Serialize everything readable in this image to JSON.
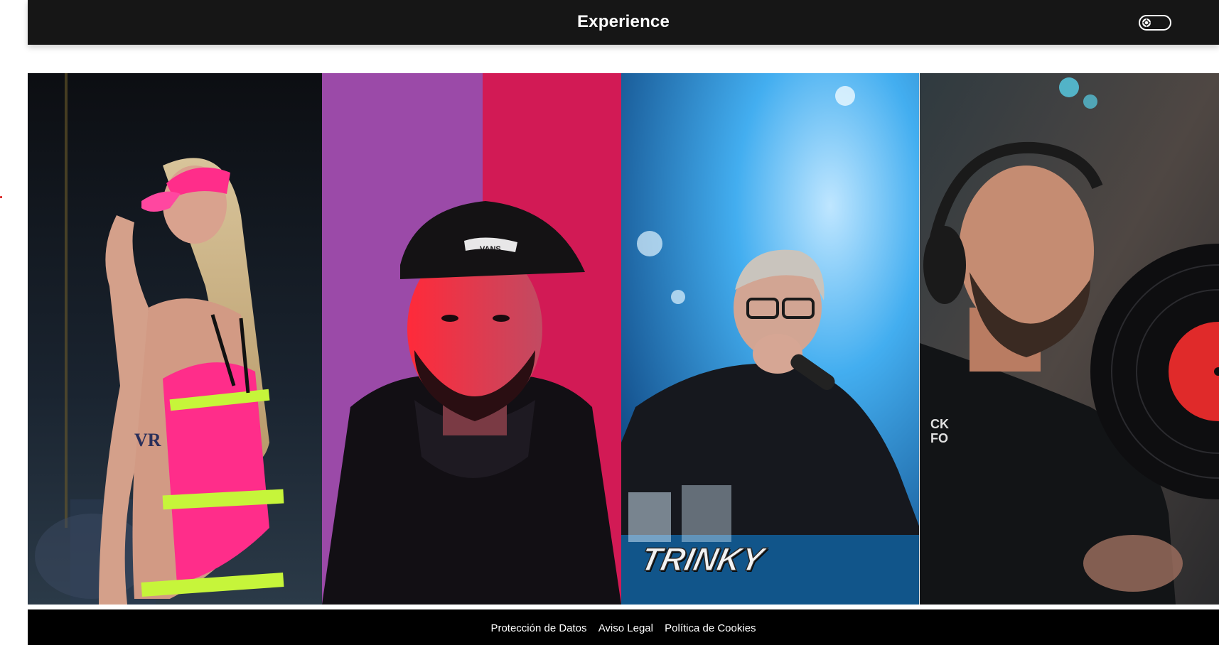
{
  "header": {
    "title": "Experience",
    "toggle_icon": "gear-icon"
  },
  "gallery": {
    "items": [
      {
        "icon": "performer-photo",
        "description_visible": false
      },
      {
        "icon": "artist-portrait-photo",
        "description_visible": false
      },
      {
        "icon": "mc-performer-photo",
        "caption": "TRINKY"
      },
      {
        "icon": "dj-vinyl-photo",
        "description_visible": false
      }
    ]
  },
  "footer": {
    "links": [
      {
        "label": "Protección de Datos"
      },
      {
        "label": "Aviso Legal"
      },
      {
        "label": "Política de Cookies"
      }
    ]
  },
  "colors": {
    "header_bg": "#161616",
    "footer_bg": "#000000",
    "accent_pink": "#ff2d8a",
    "accent_blue": "#2a9ee8",
    "marker_red": "#d40000"
  }
}
